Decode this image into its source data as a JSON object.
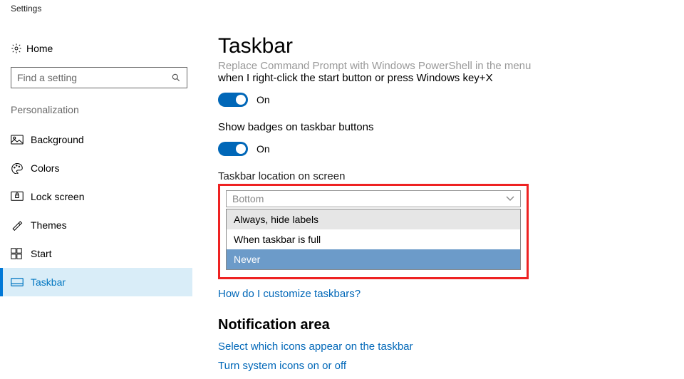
{
  "window": {
    "title": "Settings"
  },
  "sidebar": {
    "home": "Home",
    "search_placeholder": "Find a setting",
    "section": "Personalization",
    "items": [
      {
        "label": "Background"
      },
      {
        "label": "Colors"
      },
      {
        "label": "Lock screen"
      },
      {
        "label": "Themes"
      },
      {
        "label": "Start"
      },
      {
        "label": "Taskbar"
      }
    ]
  },
  "main": {
    "title": "Taskbar",
    "replace_cmd": {
      "line1": "Replace Command Prompt with Windows PowerShell in the menu",
      "line2": "when I right-click the start button or press Windows key+X",
      "state": "On"
    },
    "badges": {
      "label": "Show badges on taskbar buttons",
      "state": "On"
    },
    "location": {
      "label": "Taskbar location on screen",
      "value": "Bottom"
    },
    "combine": {
      "options": [
        "Always, hide labels",
        "When taskbar is full",
        "Never"
      ],
      "selected": "Never"
    },
    "help_link": "How do I customize taskbars?",
    "notification_area": {
      "heading": "Notification area",
      "link1": "Select which icons appear on the taskbar",
      "link2": "Turn system icons on or off"
    }
  }
}
